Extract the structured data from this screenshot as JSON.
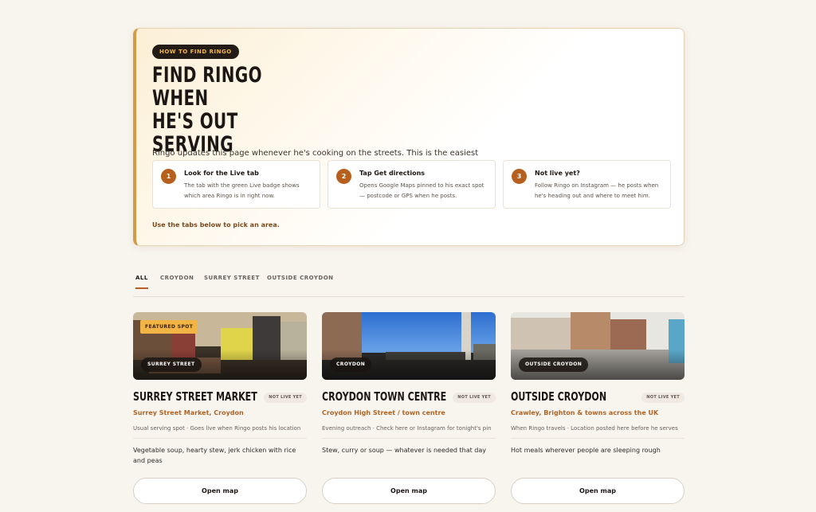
{
  "hero": {
    "eyebrow": "HOW TO FIND RINGO",
    "title_line1": "FIND RINGO WHEN",
    "title_line2": "HE'S OUT SERVING",
    "description": "Ringo updates this page whenever he's cooking on the streets. This is the easiest way to see where he is and get to him.",
    "steps": [
      {
        "num": "1",
        "title": "Look for the Live tab",
        "desc": "The tab with the green Live badge shows which area Ringo is in right now."
      },
      {
        "num": "2",
        "title": "Tap Get directions",
        "desc": "Opens Google Maps pinned to his exact spot — postcode or GPS when he posts."
      },
      {
        "num": "3",
        "title": "Not live yet?",
        "desc": "Follow Ringo on Instagram — he posts when he's heading out and where to meet him."
      }
    ],
    "note": "Use the tabs below to pick an area."
  },
  "tabs": [
    {
      "label": "ALL",
      "active": true
    },
    {
      "label": "CROYDON",
      "active": false
    },
    {
      "label": "SURREY STREET",
      "active": false
    },
    {
      "label": "OUTSIDE CROYDON",
      "active": false
    }
  ],
  "cards": [
    {
      "chip": "SURREY STREET",
      "featured": "FEATURED SPOT",
      "title": "SURREY STREET MARKET",
      "status": "NOT LIVE YET",
      "location": "Surrey Street Market, Croydon",
      "meta": "Usual serving spot · Goes live when Ringo posts his location",
      "food": "Vegetable soup, hearty stew, jerk chicken with rice and peas",
      "button": "Open map"
    },
    {
      "chip": "CROYDON",
      "title": "CROYDON TOWN CENTRE",
      "status": "NOT LIVE YET",
      "location": "Croydon High Street / town centre",
      "meta": "Evening outreach · Check here or Instagram for tonight's pin",
      "food": "Stew, curry or soup — whatever is needed that day",
      "button": "Open map"
    },
    {
      "chip": "OUTSIDE CROYDON",
      "title": "OUTSIDE CROYDON",
      "status": "NOT LIVE YET",
      "location": "Crawley, Brighton & towns across the UK",
      "meta": "When Ringo travels · Location posted here before he serves",
      "food": "Hot meals wherever people are sleeping rough",
      "button": "Open map"
    }
  ]
}
